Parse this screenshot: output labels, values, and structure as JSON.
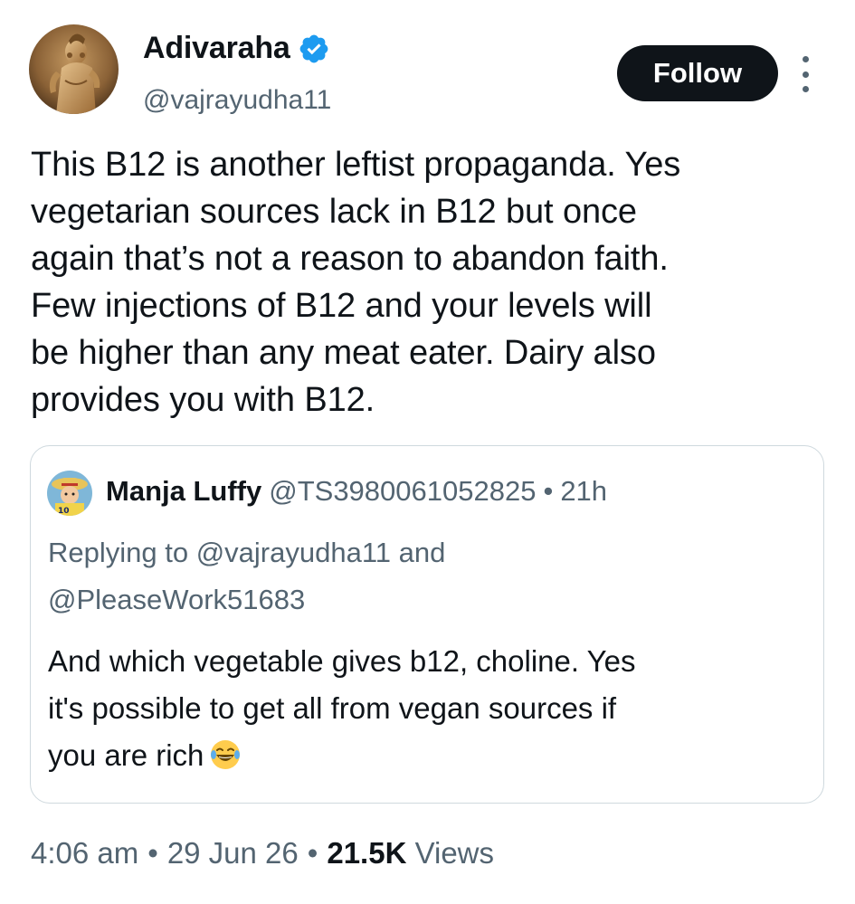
{
  "author": {
    "display_name": "Adivaraha",
    "handle": "@vajrayudha11",
    "verified_icon": "verified-badge-icon",
    "verified_color": "#1d9bf0",
    "avatar_icon": "statue-avatar"
  },
  "actions": {
    "follow_label": "Follow",
    "more_icon": "more-vertical-icon"
  },
  "tweet": {
    "lines": [
      "This B12 is another leftist propaganda. Yes",
      "vegetarian sources lack in B12 but once",
      "again that’s not a reason to abandon faith.",
      "Few injections of B12 and your levels will",
      "be higher than any meat eater. Dairy also",
      "provides you with B12."
    ]
  },
  "quote": {
    "display_name": "Manja Luffy",
    "handle": "@TS3980061052825",
    "separator": "•",
    "time": "21h",
    "replying_lines": [
      "Replying to @vajrayudha11 and",
      "@PleaseWork51683"
    ],
    "text_lines": [
      "And which vegetable gives b12, choline. Yes",
      "it's possible to get all from vegan sources if",
      "you are rich"
    ],
    "emoji_icon": "laughing-tears-emoji"
  },
  "footer": {
    "time": "4:06 am",
    "sep1": "•",
    "date": "29 Jun 26",
    "sep2": "•",
    "views_count": "21.5K",
    "views_label": "Views"
  },
  "colors": {
    "text": "#0f1419",
    "secondary": "#536471",
    "border": "#cfd9de",
    "follow_bg": "#0f1419"
  }
}
